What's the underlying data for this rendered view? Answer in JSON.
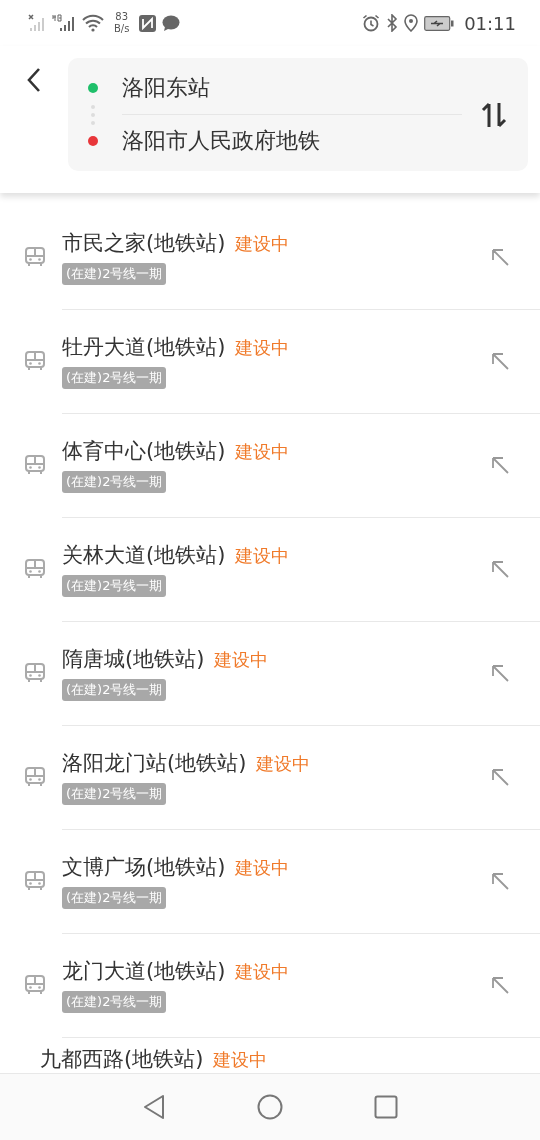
{
  "status_bar": {
    "net_speed_value": "83",
    "net_speed_unit": "B/s",
    "time": "01:11"
  },
  "route": {
    "origin": {
      "name": "洛阳东站",
      "color": "#1fbf6a"
    },
    "destination": {
      "name": "洛阳市人民政府地铁",
      "color": "#e8363a"
    }
  },
  "results": [
    {
      "name": "市民之家(地铁站)",
      "status": "建设中",
      "line": "(在建)2号线一期"
    },
    {
      "name": "牡丹大道(地铁站)",
      "status": "建设中",
      "line": "(在建)2号线一期"
    },
    {
      "name": "体育中心(地铁站)",
      "status": "建设中",
      "line": "(在建)2号线一期"
    },
    {
      "name": "关林大道(地铁站)",
      "status": "建设中",
      "line": "(在建)2号线一期"
    },
    {
      "name": "隋唐城(地铁站)",
      "status": "建设中",
      "line": "(在建)2号线一期"
    },
    {
      "name": "洛阳龙门站(地铁站)",
      "status": "建设中",
      "line": "(在建)2号线一期"
    },
    {
      "name": "文博广场(地铁站)",
      "status": "建设中",
      "line": "(在建)2号线一期"
    },
    {
      "name": "龙门大道(地铁站)",
      "status": "建设中",
      "line": "(在建)2号线一期"
    },
    {
      "name": "九都西路(地铁站)",
      "status": "建设中"
    }
  ]
}
